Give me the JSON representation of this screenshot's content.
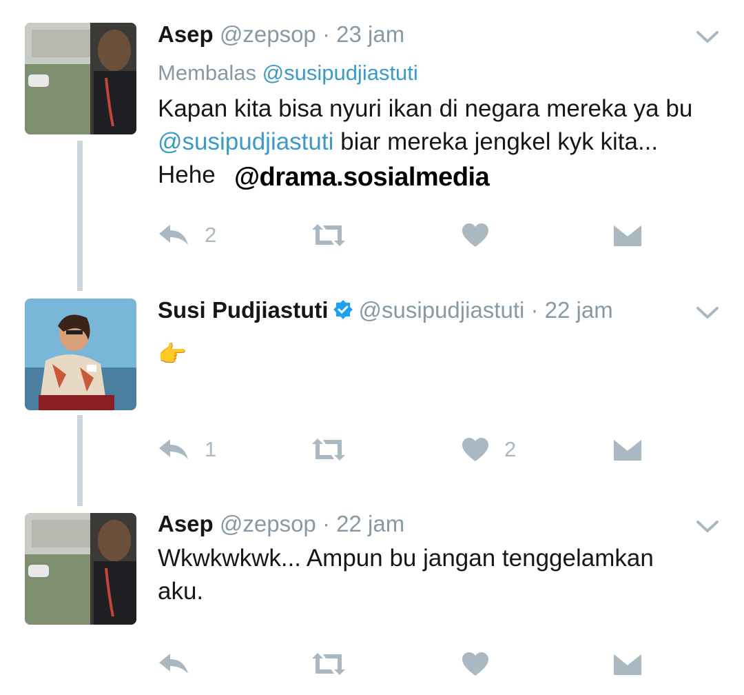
{
  "tweets": [
    {
      "name": "Asep",
      "handle": "@zepsop",
      "sep": "·",
      "time": "23 jam",
      "reply_prefix": "Membalas ",
      "reply_mention": "@susipudjiastuti",
      "text_line1": "Kapan kita bisa nyuri ikan di negara mereka ya bu",
      "text_mention": "@susipudjiastuti",
      "text_line2_rest": " biar mereka jengkel kyk kita...",
      "text_line3": "Hehe",
      "reply_count": "2",
      "like_count": ""
    },
    {
      "name": "Susi Pudjiastuti",
      "verified": true,
      "handle": "@susipudjiastuti",
      "sep": "·",
      "time": "22 jam",
      "emoji": "👉",
      "reply_count": "1",
      "like_count": "2"
    },
    {
      "name": "Asep",
      "handle": "@zepsop",
      "sep": "·",
      "time": "22 jam",
      "text_line1": "Wkwkwkwk... Ampun bu jangan tenggelamkan",
      "text_line2": "aku.",
      "reply_count": "",
      "like_count": ""
    }
  ],
  "watermark": "@drama.sosialmedia",
  "colors": {
    "muted": "#8899a6",
    "link": "#3a9ac8",
    "icon": "#aab8c2",
    "verified": "#1da1f2"
  },
  "icons": [
    "reply-icon",
    "retweet-icon",
    "like-icon",
    "message-icon",
    "chevron-down-icon",
    "verified-badge-icon"
  ]
}
